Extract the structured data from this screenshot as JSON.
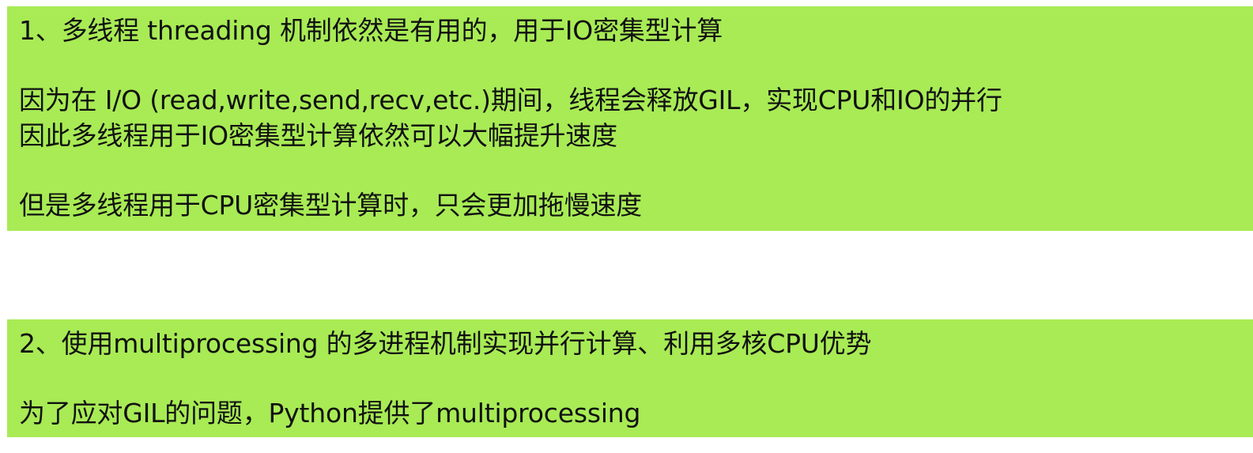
{
  "block1": {
    "heading": "1、多线程 threading 机制依然是有用的，用于IO密集型计算",
    "line_2": "因为在 I/O (read,write,send,recv,etc.)期间，线程会释放GIL，实现CPU和IO的并行",
    "line_3": "因此多线程用于IO密集型计算依然可以大幅提升速度",
    "line_4": "但是多线程用于CPU密集型计算时，只会更加拖慢速度"
  },
  "block2": {
    "heading": "2、使用multiprocessing 的多进程机制实现并行计算、利用多核CPU优势",
    "line_2": "为了应对GIL的问题，Python提供了multiprocessing"
  },
  "colors": {
    "block_background": "#a8eb55",
    "text": "#111111",
    "page_background": "#ffffff"
  }
}
